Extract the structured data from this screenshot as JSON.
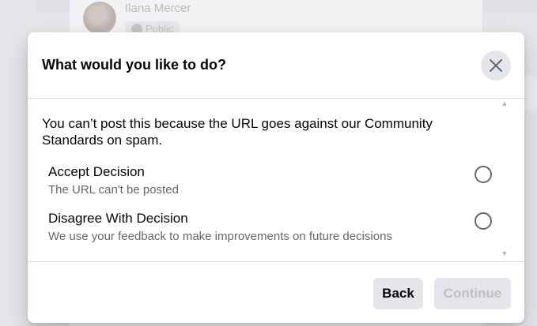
{
  "background": {
    "author_name": "Ilana Mercer",
    "privacy_label": "Public"
  },
  "modal": {
    "title": "What would you like to do?",
    "close_icon": "close-icon",
    "message": "You can’t post this because the URL goes against our Community Standards on spam.",
    "options": [
      {
        "title": "Accept Decision",
        "description": "The URL can't be posted",
        "selected": false
      },
      {
        "title": "Disagree With Decision",
        "description": "We use your feedback to make improvements on future decisions",
        "selected": false
      }
    ],
    "buttons": {
      "back": "Back",
      "continue": "Continue"
    }
  },
  "colors": {
    "primary_text": "#050505",
    "secondary_text": "#65676b",
    "button_bg": "#e4e6eb",
    "disabled_text": "#bcc0c4"
  }
}
